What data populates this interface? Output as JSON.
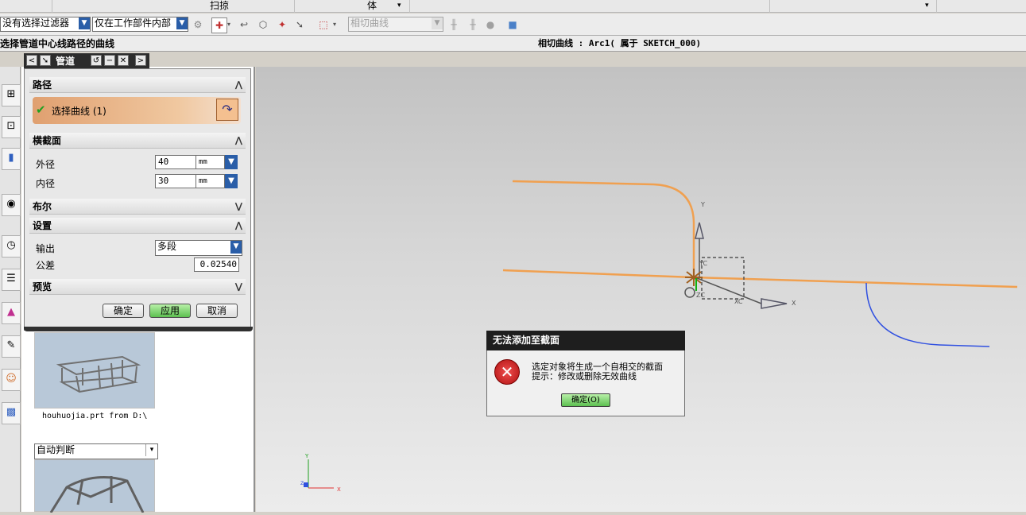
{
  "menubar": {
    "scan": "扫掠",
    "body": "体"
  },
  "toolbar": {
    "filter": "没有选择过滤器",
    "scope": "仅在工作部件内部",
    "curve_rule": "相切曲线"
  },
  "status": {
    "prompt": "选择管道中心线路径的曲线",
    "info": "相切曲线 : Arc1( 属于 SKETCH_000)"
  },
  "dialog": {
    "title": "管道",
    "sections": {
      "path": "路径",
      "cross_section": "横截面",
      "boolean": "布尔",
      "settings": "设置",
      "preview": "预览"
    },
    "select_curve": "选择曲线 (1)",
    "outer_label": "外径",
    "outer_value": "40",
    "inner_label": "内径",
    "inner_value": "30",
    "unit": "mm",
    "output_label": "输出",
    "output_value": "多段",
    "tolerance_label": "公差",
    "tolerance_value": "0.02540",
    "ok": "确定",
    "apply": "应用",
    "cancel": "取消"
  },
  "navpanel": {
    "file_caption": "houhuojia.prt from D:\\",
    "mode": "自动判断"
  },
  "error": {
    "title": "无法添加至截面",
    "line1": "选定对象将生成一个自相交的截面",
    "line2": "提示：修改或删除无效曲线",
    "ok": "确定(O)"
  },
  "axes": {
    "x": "X",
    "y": "Y",
    "z": "Z",
    "xc": "XC",
    "yc": "YC",
    "zc": "ZC"
  },
  "colors": {
    "path_curve": "#f0a050",
    "other_curve": "#3050e0",
    "dialog_title": "#2c2c2c"
  }
}
